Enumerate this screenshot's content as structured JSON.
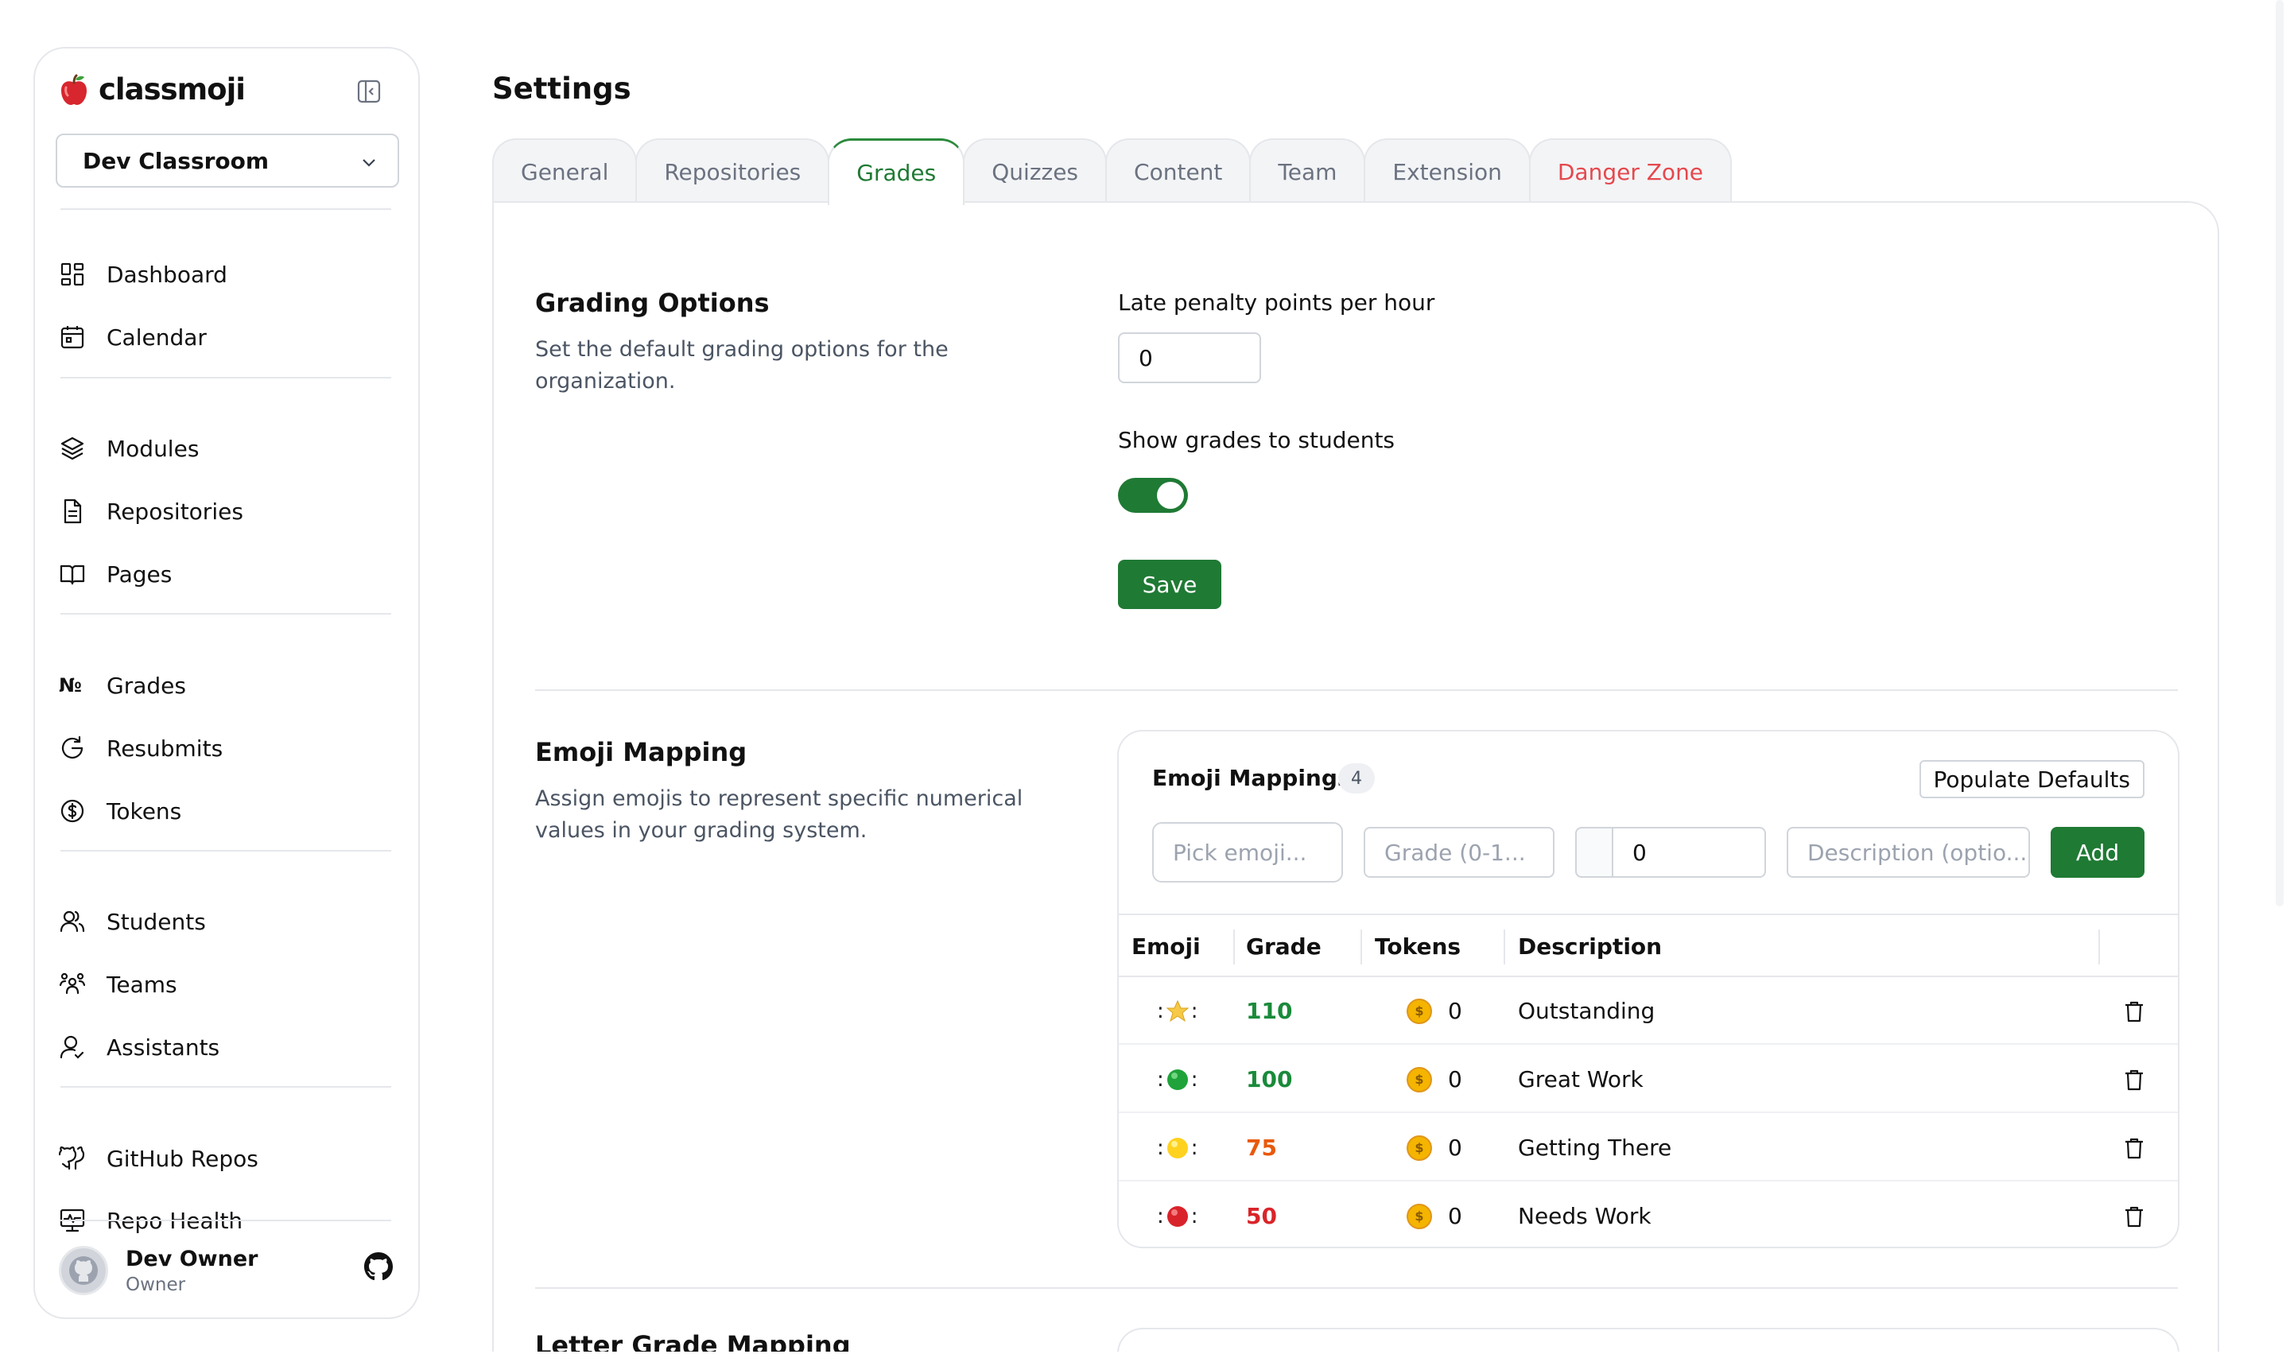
{
  "sidebar": {
    "brand": "classmoji",
    "classroom": "Dev Classroom",
    "groups": [
      [
        {
          "label": "Dashboard",
          "icon": "dashboard-icon"
        },
        {
          "label": "Calendar",
          "icon": "calendar-icon"
        }
      ],
      [
        {
          "label": "Modules",
          "icon": "layers-icon"
        },
        {
          "label": "Repositories",
          "icon": "file-icon"
        },
        {
          "label": "Pages",
          "icon": "book-icon"
        }
      ],
      [
        {
          "label": "Grades",
          "icon": "numero-icon"
        },
        {
          "label": "Resubmits",
          "icon": "resubmit-icon"
        },
        {
          "label": "Tokens",
          "icon": "dollar-icon"
        }
      ],
      [
        {
          "label": "Students",
          "icon": "users-icon"
        },
        {
          "label": "Teams",
          "icon": "team-icon"
        },
        {
          "label": "Assistants",
          "icon": "assistant-icon"
        }
      ],
      [
        {
          "label": "GitHub Repos",
          "icon": "github-icon"
        },
        {
          "label": "Repo Health",
          "icon": "monitor-icon"
        }
      ]
    ],
    "user": {
      "name": "Dev Owner",
      "role": "Owner"
    }
  },
  "page": {
    "title": "Settings"
  },
  "tabs": [
    {
      "label": "General",
      "active": false,
      "danger": false
    },
    {
      "label": "Repositories",
      "active": false,
      "danger": false
    },
    {
      "label": "Grades",
      "active": true,
      "danger": false
    },
    {
      "label": "Quizzes",
      "active": false,
      "danger": false
    },
    {
      "label": "Content",
      "active": false,
      "danger": false
    },
    {
      "label": "Team",
      "active": false,
      "danger": false
    },
    {
      "label": "Extension",
      "active": false,
      "danger": false
    },
    {
      "label": "Danger Zone",
      "active": false,
      "danger": true
    }
  ],
  "grading": {
    "title": "Grading Options",
    "description": "Set the default grading options for the organization.",
    "late_penalty_label": "Late penalty points per hour",
    "late_penalty_value": "0",
    "show_grades_label": "Show grades to students",
    "show_grades_on": true,
    "save_label": "Save"
  },
  "emoji": {
    "title": "Emoji Mapping",
    "description": "Assign emojis to represent specific numerical values in your grading system.",
    "card_title": "Emoji Mappings",
    "count": "4",
    "populate_label": "Populate Defaults",
    "emoji_placeholder": "Pick emoji...",
    "grade_placeholder": "Grade (0-1...",
    "tokens_value": "0",
    "description_placeholder": "Description (optio...",
    "add_label": "Add",
    "columns": [
      "Emoji",
      "Grade",
      "Tokens",
      "Description"
    ],
    "rows": [
      {
        "emoji": "star",
        "grade": "110",
        "tokens": "0",
        "description": "Outstanding",
        "color": "#1a8a3a"
      },
      {
        "emoji": "green-circle",
        "grade": "100",
        "tokens": "0",
        "description": "Great Work",
        "color": "#1a8a3a"
      },
      {
        "emoji": "yellow-circle",
        "grade": "75",
        "tokens": "0",
        "description": "Getting There",
        "color": "#e8590c"
      },
      {
        "emoji": "red-circle",
        "grade": "50",
        "tokens": "0",
        "description": "Needs Work",
        "color": "#d9252a"
      }
    ]
  },
  "letter": {
    "title": "Letter Grade Mapping"
  },
  "colors": {
    "accent": "#1f7a34",
    "danger": "#e5484d"
  }
}
